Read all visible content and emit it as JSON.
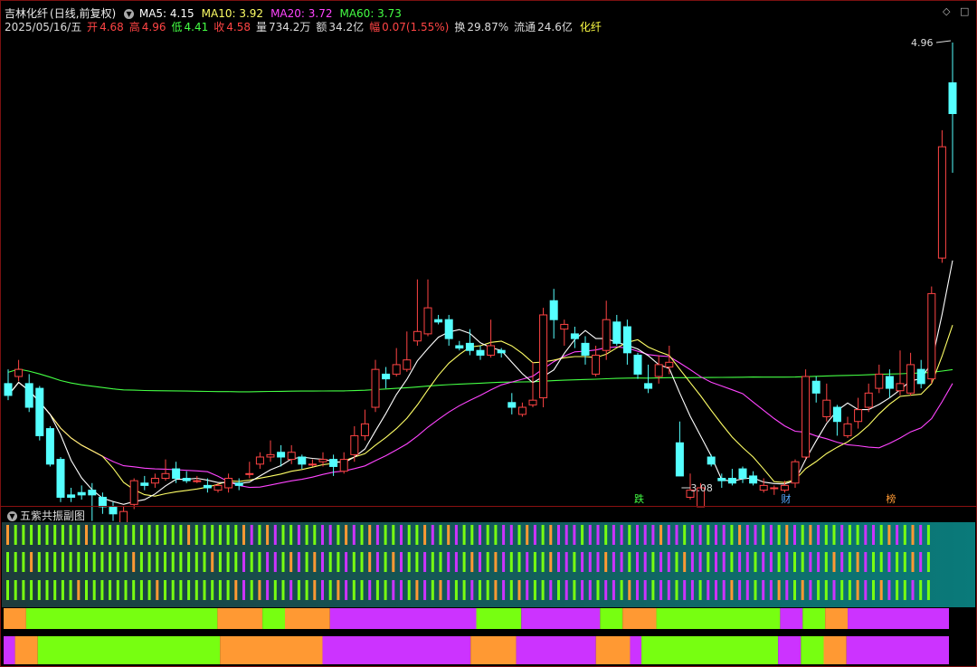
{
  "header": {
    "stock_name": "吉林化纤",
    "stock_mode": "(日线,前复权)",
    "ma_items": [
      {
        "label": "MA5: 4.15",
        "color": "#ffffff"
      },
      {
        "label": "MA10: 3.92",
        "color": "#ffff66"
      },
      {
        "label": "MA20: 3.72",
        "color": "#ff44ff"
      },
      {
        "label": "MA60: 3.73",
        "color": "#44ff44"
      }
    ],
    "date": "2025/05/16/五",
    "quote_items": [
      {
        "label": "开",
        "value": "4.68",
        "color": "#ff4444"
      },
      {
        "label": "高",
        "value": "4.96",
        "color": "#ff4444"
      },
      {
        "label": "低",
        "value": "4.41",
        "color": "#44ff44"
      },
      {
        "label": "收",
        "value": "4.58",
        "color": "#ff4444"
      },
      {
        "label": "量",
        "value": "734.2万",
        "color": "#dddddd"
      },
      {
        "label": "额",
        "value": "34.2亿",
        "color": "#dddddd"
      },
      {
        "label": "幅",
        "value": "0.07(1.55%)",
        "color": "#ff4444"
      },
      {
        "label": "换",
        "value": "29.87%",
        "color": "#dddddd"
      },
      {
        "label": "流通",
        "value": "24.6亿",
        "color": "#dddddd"
      },
      {
        "label": "",
        "value": "化纤",
        "color": "#ffff44"
      }
    ],
    "icons": [
      "diamond-icon",
      "square-icon"
    ]
  },
  "subchart": {
    "title": "五紫共振副图"
  },
  "chart_data": {
    "type": "candlestick",
    "up_color": "#ff4444",
    "down_color": "#55ffff",
    "ma_colors": {
      "MA5": "#ffffff",
      "MA10": "#ffff66",
      "MA20": "#ff44ff",
      "MA60": "#44ff44"
    },
    "annotations": {
      "high_label": "4.96",
      "low_label": "3.08"
    },
    "event_markers": [
      {
        "index": 60,
        "label": "跌",
        "color": "#44ff44"
      },
      {
        "index": 74,
        "label": "财",
        "color": "#55aaff"
      },
      {
        "index": 84,
        "label": "榜",
        "color": "#ff9933"
      }
    ],
    "candles": [
      [
        3.52,
        3.47,
        3.58,
        3.45
      ],
      [
        3.55,
        3.58,
        3.62,
        3.53
      ],
      [
        3.52,
        3.42,
        3.56,
        3.4
      ],
      [
        3.5,
        3.3,
        3.51,
        3.28
      ],
      [
        3.33,
        3.18,
        3.34,
        3.17
      ],
      [
        3.2,
        3.04,
        3.21,
        3.02
      ],
      [
        3.05,
        3.04,
        3.08,
        3.02
      ],
      [
        3.06,
        3.05,
        3.09,
        3.03
      ],
      [
        3.07,
        3.05,
        3.1,
        2.94
      ],
      [
        3.04,
        3.0,
        3.06,
        2.97
      ],
      [
        3.0,
        2.97,
        3.02,
        2.94
      ],
      [
        2.93,
        2.98,
        3.0,
        2.92
      ],
      [
        3.01,
        3.11,
        3.12,
        2.99
      ],
      [
        3.1,
        3.09,
        3.13,
        3.07
      ],
      [
        3.1,
        3.12,
        3.14,
        3.08
      ],
      [
        3.12,
        3.14,
        3.2,
        3.11
      ],
      [
        3.16,
        3.12,
        3.19,
        3.1
      ],
      [
        3.12,
        3.11,
        3.15,
        3.1
      ],
      [
        3.11,
        3.11,
        3.13,
        3.1
      ],
      [
        3.09,
        3.08,
        3.12,
        3.06
      ],
      [
        3.07,
        3.09,
        3.1,
        3.06
      ],
      [
        3.08,
        3.12,
        3.14,
        3.06
      ],
      [
        3.1,
        3.09,
        3.12,
        3.07
      ],
      [
        3.14,
        3.14,
        3.19,
        3.12
      ],
      [
        3.18,
        3.21,
        3.23,
        3.16
      ],
      [
        3.21,
        3.22,
        3.28,
        3.19
      ],
      [
        3.23,
        3.21,
        3.26,
        3.17
      ],
      [
        3.2,
        3.23,
        3.26,
        3.18
      ],
      [
        3.21,
        3.18,
        3.22,
        3.16
      ],
      [
        3.18,
        3.18,
        3.2,
        3.17
      ],
      [
        3.19,
        3.2,
        3.23,
        3.17
      ],
      [
        3.2,
        3.17,
        3.22,
        3.13
      ],
      [
        3.15,
        3.2,
        3.23,
        3.14
      ],
      [
        3.22,
        3.3,
        3.34,
        3.19
      ],
      [
        3.3,
        3.35,
        3.41,
        3.28
      ],
      [
        3.42,
        3.58,
        3.62,
        3.4
      ],
      [
        3.56,
        3.54,
        3.59,
        3.5
      ],
      [
        3.56,
        3.6,
        3.67,
        3.55
      ],
      [
        3.58,
        3.62,
        3.74,
        3.57
      ],
      [
        3.7,
        3.74,
        3.96,
        3.68
      ],
      [
        3.73,
        3.84,
        3.96,
        3.72
      ],
      [
        3.79,
        3.78,
        3.81,
        3.77
      ],
      [
        3.79,
        3.71,
        3.81,
        3.68
      ],
      [
        3.68,
        3.67,
        3.7,
        3.66
      ],
      [
        3.69,
        3.66,
        3.75,
        3.64
      ],
      [
        3.66,
        3.64,
        3.68,
        3.62
      ],
      [
        3.64,
        3.68,
        3.79,
        3.63
      ],
      [
        3.66,
        3.65,
        3.67,
        3.63
      ],
      [
        3.44,
        3.42,
        3.48,
        3.39
      ],
      [
        3.39,
        3.42,
        3.44,
        3.38
      ],
      [
        3.43,
        3.45,
        3.61,
        3.42
      ],
      [
        3.46,
        3.81,
        3.84,
        3.42
      ],
      [
        3.87,
        3.79,
        3.92,
        3.71
      ],
      [
        3.75,
        3.77,
        3.79,
        3.68
      ],
      [
        3.73,
        3.71,
        3.76,
        3.67
      ],
      [
        3.69,
        3.64,
        3.72,
        3.6
      ],
      [
        3.56,
        3.64,
        3.68,
        3.55
      ],
      [
        3.66,
        3.79,
        3.87,
        3.62
      ],
      [
        3.78,
        3.69,
        3.81,
        3.68
      ],
      [
        3.76,
        3.65,
        3.79,
        3.6
      ],
      [
        3.64,
        3.56,
        3.65,
        3.54
      ],
      [
        3.52,
        3.5,
        3.6,
        3.48
      ],
      [
        3.55,
        3.6,
        3.64,
        3.52
      ],
      [
        3.59,
        3.61,
        3.68,
        3.56
      ],
      [
        3.27,
        3.13,
        3.36,
        3.13
      ],
      [
        3.04,
        3.07,
        3.14,
        3.03
      ],
      [
        3.0,
        3.08,
        3.1,
        3.04
      ],
      [
        3.21,
        3.18,
        3.22,
        3.17
      ],
      [
        3.12,
        3.11,
        3.14,
        3.08
      ],
      [
        3.12,
        3.1,
        3.16,
        3.09
      ],
      [
        3.16,
        3.12,
        3.17,
        3.1
      ],
      [
        3.13,
        3.1,
        3.15,
        3.09
      ],
      [
        3.07,
        3.09,
        3.12,
        3.06
      ],
      [
        3.08,
        3.08,
        3.09,
        3.05
      ],
      [
        3.07,
        3.09,
        3.11,
        3.06
      ],
      [
        3.1,
        3.19,
        3.2,
        3.08
      ],
      [
        3.21,
        3.55,
        3.58,
        3.2
      ],
      [
        3.53,
        3.48,
        3.55,
        3.44
      ],
      [
        3.38,
        3.45,
        3.52,
        3.36
      ],
      [
        3.42,
        3.36,
        3.43,
        3.3
      ],
      [
        3.3,
        3.35,
        3.38,
        3.29
      ],
      [
        3.36,
        3.41,
        3.46,
        3.33
      ],
      [
        3.42,
        3.48,
        3.52,
        3.4
      ],
      [
        3.5,
        3.56,
        3.6,
        3.48
      ],
      [
        3.55,
        3.5,
        3.58,
        3.46
      ],
      [
        3.49,
        3.52,
        3.66,
        3.47
      ],
      [
        3.48,
        3.6,
        3.65,
        3.47
      ],
      [
        3.58,
        3.52,
        3.62,
        3.5
      ],
      [
        3.54,
        3.9,
        3.93,
        3.52
      ],
      [
        4.05,
        4.52,
        4.59,
        4.03
      ],
      [
        4.79,
        4.66,
        4.96,
        4.41
      ]
    ],
    "ma_notes": "MA5/MA10/MA20/MA60 lines derived from closes",
    "sub_rows": [
      {
        "name": "row1",
        "colors": "lines"
      },
      {
        "name": "row2",
        "colors": "lines"
      },
      {
        "name": "row3",
        "colors": "lines"
      }
    ],
    "band1": [
      {
        "len": 2,
        "color": "#ff9933"
      },
      {
        "len": 17,
        "color": "#77ff11"
      },
      {
        "len": 4,
        "color": "#ff9933"
      },
      {
        "len": 2,
        "color": "#77ff11"
      },
      {
        "len": 4,
        "color": "#ff9933"
      },
      {
        "len": 13,
        "color": "#cc33ff"
      },
      {
        "len": 4,
        "color": "#77ff11"
      },
      {
        "len": 7,
        "color": "#cc33ff"
      },
      {
        "len": 2,
        "color": "#77ff11"
      },
      {
        "len": 3,
        "color": "#ff9933"
      },
      {
        "len": 11,
        "color": "#77ff11"
      },
      {
        "len": 2,
        "color": "#cc33ff"
      },
      {
        "len": 2,
        "color": "#77ff11"
      },
      {
        "len": 2,
        "color": "#ff9933"
      },
      {
        "len": 9,
        "color": "#cc33ff"
      }
    ],
    "band2": [
      {
        "len": 1,
        "color": "#cc33ff"
      },
      {
        "len": 2,
        "color": "#ff9933"
      },
      {
        "len": 16,
        "color": "#77ff11"
      },
      {
        "len": 9,
        "color": "#ff9933"
      },
      {
        "len": 13,
        "color": "#cc33ff"
      },
      {
        "len": 4,
        "color": "#ff9933"
      },
      {
        "len": 7,
        "color": "#cc33ff"
      },
      {
        "len": 3,
        "color": "#ff9933"
      },
      {
        "len": 1,
        "color": "#cc33ff"
      },
      {
        "len": 12,
        "color": "#77ff11"
      },
      {
        "len": 2,
        "color": "#cc33ff"
      },
      {
        "len": 2,
        "color": "#77ff11"
      },
      {
        "len": 2,
        "color": "#ff9933"
      },
      {
        "len": 9,
        "color": "#cc33ff"
      }
    ]
  }
}
